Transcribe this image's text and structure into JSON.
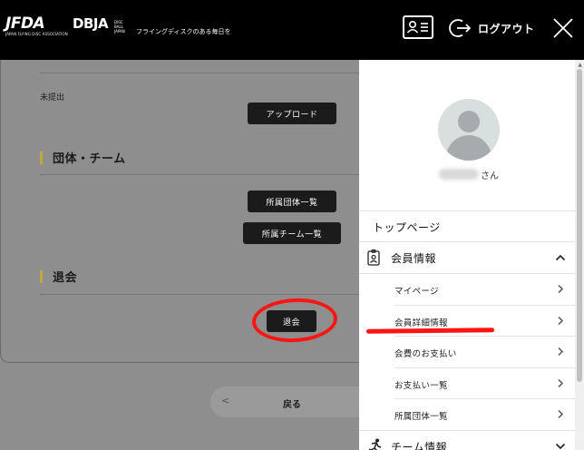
{
  "header": {
    "logo_main": "JFDA",
    "logo_sub": "JAPAN FLYING DISC ASSOCIATION",
    "logo2_main": "DBJA",
    "logo2_sub": "DISC BALL JAPAN",
    "tagline": "フライングディスクのある毎日を",
    "logout_label": "ログアウト"
  },
  "background": {
    "status_text": "未提出",
    "upload_button": "アップロード",
    "section_team_title": "団体・チーム",
    "affiliated_org_button": "所属団体一覧",
    "affiliated_team_button": "所属チーム一覧",
    "section_withdraw_title": "退会",
    "withdraw_button": "退会",
    "back_arrow": "<",
    "back_label": "戻る"
  },
  "panel": {
    "name_suffix": "さん",
    "top_page": "トップページ",
    "member_info": {
      "label": "会員情報",
      "icon": "id-badge-icon",
      "items": [
        {
          "label": "マイページ"
        },
        {
          "label": "会員詳細情報"
        },
        {
          "label": "会費のお支払い"
        },
        {
          "label": "お支払い一覧"
        },
        {
          "label": "所属団体一覧"
        }
      ]
    },
    "team_info": {
      "label": "チーム情報",
      "icon": "running-person-icon"
    }
  },
  "colors": {
    "header_bg": "#000000",
    "overlay_bg": "#8e8e8e",
    "accent_bar": "#bfa93a",
    "annotation_red": "#ff1414"
  }
}
